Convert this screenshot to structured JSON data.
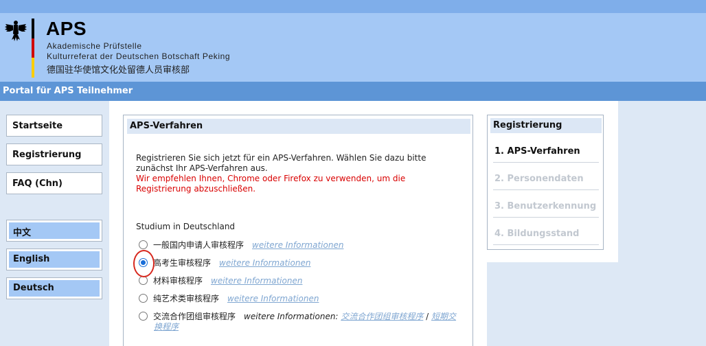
{
  "header": {
    "title": "APS",
    "subtitle1": "Akademische Prüfstelle",
    "subtitle2": "Kulturreferat der Deutschen Botschaft Peking",
    "subtitle3": "德国驻华使馆文化处留德人员审核部",
    "flag_colors": [
      "#000000",
      "#d00000",
      "#ffce00"
    ]
  },
  "portal_bar": "Portal für APS Teilnehmer",
  "nav": {
    "items": [
      {
        "label": "Startseite"
      },
      {
        "label": "Registrierung"
      },
      {
        "label": "FAQ (Chn)"
      }
    ],
    "languages": [
      {
        "label": "中文"
      },
      {
        "label": "English"
      },
      {
        "label": "Deutsch"
      }
    ]
  },
  "main": {
    "heading": "APS-Verfahren",
    "intro": "Registrieren Sie sich jetzt für ein APS-Verfahren. Wählen Sie dazu bitte zunächst Ihr APS-Verfahren aus.",
    "warning": "Wir empfehlen Ihnen, Chrome oder Firefox zu verwenden, um die Registrierung abzuschließen.",
    "section_title": "Studium in Deutschland",
    "options": [
      {
        "label": "一般国内申请人审核程序",
        "link": "weitere Informationen",
        "checked": false
      },
      {
        "label": "高考生审核程序",
        "link": "weitere Informationen",
        "checked": true
      },
      {
        "label": "材料审核程序",
        "link": "weitere Informationen",
        "checked": false
      },
      {
        "label": "纯艺术类审核程序",
        "link": "weitere Informationen",
        "checked": false
      },
      {
        "label": "交流合作团组审核程序",
        "more_text": "weitere Informationen:",
        "link1": "交流合作团组审核程序",
        "separator": "/",
        "link2": "短期交换程序",
        "checked": false
      }
    ]
  },
  "registration": {
    "heading": "Registrierung",
    "steps": [
      {
        "label": "1. APS-Verfahren",
        "active": true
      },
      {
        "label": "2. Personendaten",
        "active": false
      },
      {
        "label": "3. Benutzerkennung",
        "active": false
      },
      {
        "label": "4. Bildungsstand",
        "active": false
      }
    ]
  },
  "colors": {
    "header_bg": "#a4c8f5",
    "portal_bar": "#5d95d6",
    "link": "#7fa6d1",
    "warning": "#d90000",
    "highlight_circle": "#d7281e"
  }
}
